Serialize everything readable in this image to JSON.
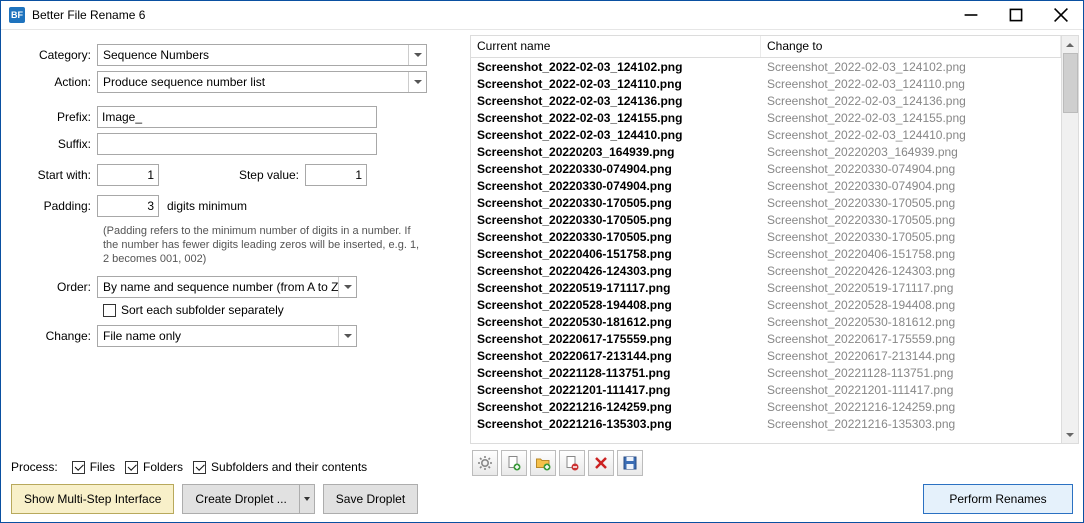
{
  "window": {
    "title": "Better File Rename 6"
  },
  "labels": {
    "category": "Category:",
    "action": "Action:",
    "prefix": "Prefix:",
    "suffix": "Suffix:",
    "startwith": "Start with:",
    "stepvalue": "Step value:",
    "padding": "Padding:",
    "digitsmin": "digits minimum",
    "padding_hint": "(Padding refers to the minimum number of digits in a number. If the number has fewer digits leading zeros will be inserted, e.g. 1, 2 becomes 001, 002)",
    "order": "Order:",
    "sort_subfolder": "Sort each subfolder separately",
    "change": "Change:",
    "process": "Process:",
    "files": "Files",
    "folders": "Folders",
    "subfolders": "Subfolders and their contents",
    "show_multi": "Show Multi-Step Interface",
    "create_droplet": "Create Droplet ...",
    "save_droplet": "Save Droplet",
    "perform": "Perform Renames"
  },
  "values": {
    "category": "Sequence Numbers",
    "action": "Produce sequence number list",
    "prefix": "Image_",
    "suffix": "",
    "startwith": "1",
    "stepvalue": "1",
    "padding": "3",
    "order": "By name and sequence number (from A to Z)",
    "change": "File name only"
  },
  "checks": {
    "sort_subfolder": false,
    "files": true,
    "folders": true,
    "subfolders": true
  },
  "table": {
    "h1": "Current name",
    "h2": "Change to",
    "rows": [
      {
        "cur": "Screenshot_2022-02-03_124102.png",
        "to": "Screenshot_2022-02-03_124102.png"
      },
      {
        "cur": "Screenshot_2022-02-03_124110.png",
        "to": "Screenshot_2022-02-03_124110.png"
      },
      {
        "cur": "Screenshot_2022-02-03_124136.png",
        "to": "Screenshot_2022-02-03_124136.png"
      },
      {
        "cur": "Screenshot_2022-02-03_124155.png",
        "to": "Screenshot_2022-02-03_124155.png"
      },
      {
        "cur": "Screenshot_2022-02-03_124410.png",
        "to": "Screenshot_2022-02-03_124410.png"
      },
      {
        "cur": "Screenshot_20220203_164939.png",
        "to": "Screenshot_20220203_164939.png"
      },
      {
        "cur": "Screenshot_20220330-074904.png",
        "to": "Screenshot_20220330-074904.png"
      },
      {
        "cur": "Screenshot_20220330-074904.png",
        "to": "Screenshot_20220330-074904.png"
      },
      {
        "cur": "Screenshot_20220330-170505.png",
        "to": "Screenshot_20220330-170505.png"
      },
      {
        "cur": "Screenshot_20220330-170505.png",
        "to": "Screenshot_20220330-170505.png"
      },
      {
        "cur": "Screenshot_20220330-170505.png",
        "to": "Screenshot_20220330-170505.png"
      },
      {
        "cur": "Screenshot_20220406-151758.png",
        "to": "Screenshot_20220406-151758.png"
      },
      {
        "cur": "Screenshot_20220426-124303.png",
        "to": "Screenshot_20220426-124303.png"
      },
      {
        "cur": "Screenshot_20220519-171117.png",
        "to": "Screenshot_20220519-171117.png"
      },
      {
        "cur": "Screenshot_20220528-194408.png",
        "to": "Screenshot_20220528-194408.png"
      },
      {
        "cur": "Screenshot_20220530-181612.png",
        "to": "Screenshot_20220530-181612.png"
      },
      {
        "cur": "Screenshot_20220617-175559.png",
        "to": "Screenshot_20220617-175559.png"
      },
      {
        "cur": "Screenshot_20220617-213144.png",
        "to": "Screenshot_20220617-213144.png"
      },
      {
        "cur": "Screenshot_20221128-113751.png",
        "to": "Screenshot_20221128-113751.png"
      },
      {
        "cur": "Screenshot_20221201-111417.png",
        "to": "Screenshot_20221201-111417.png"
      },
      {
        "cur": "Screenshot_20221216-124259.png",
        "to": "Screenshot_20221216-124259.png"
      },
      {
        "cur": "Screenshot_20221216-135303.png",
        "to": "Screenshot_20221216-135303.png"
      }
    ]
  },
  "toolbar_icons": [
    "gear-icon",
    "file-add-icon",
    "folder-add-icon",
    "file-remove-icon",
    "delete-x-icon",
    "save-disk-icon"
  ]
}
